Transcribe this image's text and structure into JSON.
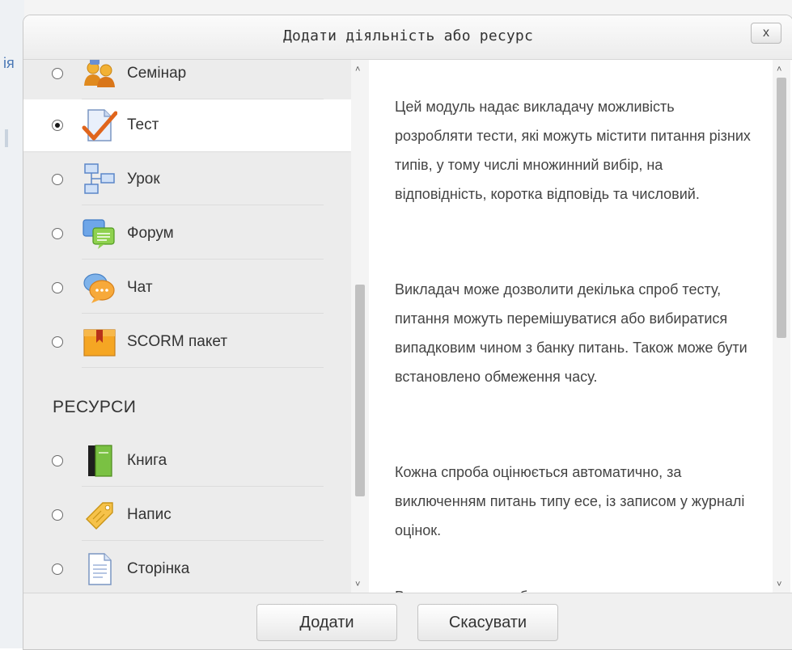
{
  "background": {
    "side_text": "ія"
  },
  "dialog": {
    "title": "Додати діяльність або ресурс",
    "close_label": "x"
  },
  "activities": [
    {
      "label": "Семінар",
      "icon": "workshop-icon",
      "selected": false
    },
    {
      "label": "Тест",
      "icon": "quiz-icon",
      "selected": true
    },
    {
      "label": "Урок",
      "icon": "lesson-icon",
      "selected": false
    },
    {
      "label": "Форум",
      "icon": "forum-icon",
      "selected": false
    },
    {
      "label": "Чат",
      "icon": "chat-icon",
      "selected": false
    },
    {
      "label": "SCORM пакет",
      "icon": "scorm-icon",
      "selected": false
    }
  ],
  "resources_title": "РЕСУРСИ",
  "resources": [
    {
      "label": "Книга",
      "icon": "book-icon",
      "selected": false
    },
    {
      "label": "Напис",
      "icon": "label-icon",
      "selected": false
    },
    {
      "label": "Сторінка",
      "icon": "page-icon",
      "selected": false
    }
  ],
  "description": [
    "Цей модуль надає викладачу можливість розробляти тести, які можуть містити питання різних типів, у тому числі множинний вибір, на відповідність, коротка відповідь та числовий.",
    "Викладач може дозволити декілька спроб тесту, питання можуть перемішуватися або вибиратися випадковим чином з банку питань. Також може бути встановлено обмеження часу.",
    "Кожна спроба оцінюється автоматично, за виключенням питань типу есе, із записом у журналі оцінок.",
    "Викладач може вибрати, чи надавати"
  ],
  "buttons": {
    "add": "Додати",
    "cancel": "Скасувати"
  },
  "colors": {
    "selected_bg": "#ffffff",
    "list_bg": "#ececec",
    "text": "#333333"
  }
}
